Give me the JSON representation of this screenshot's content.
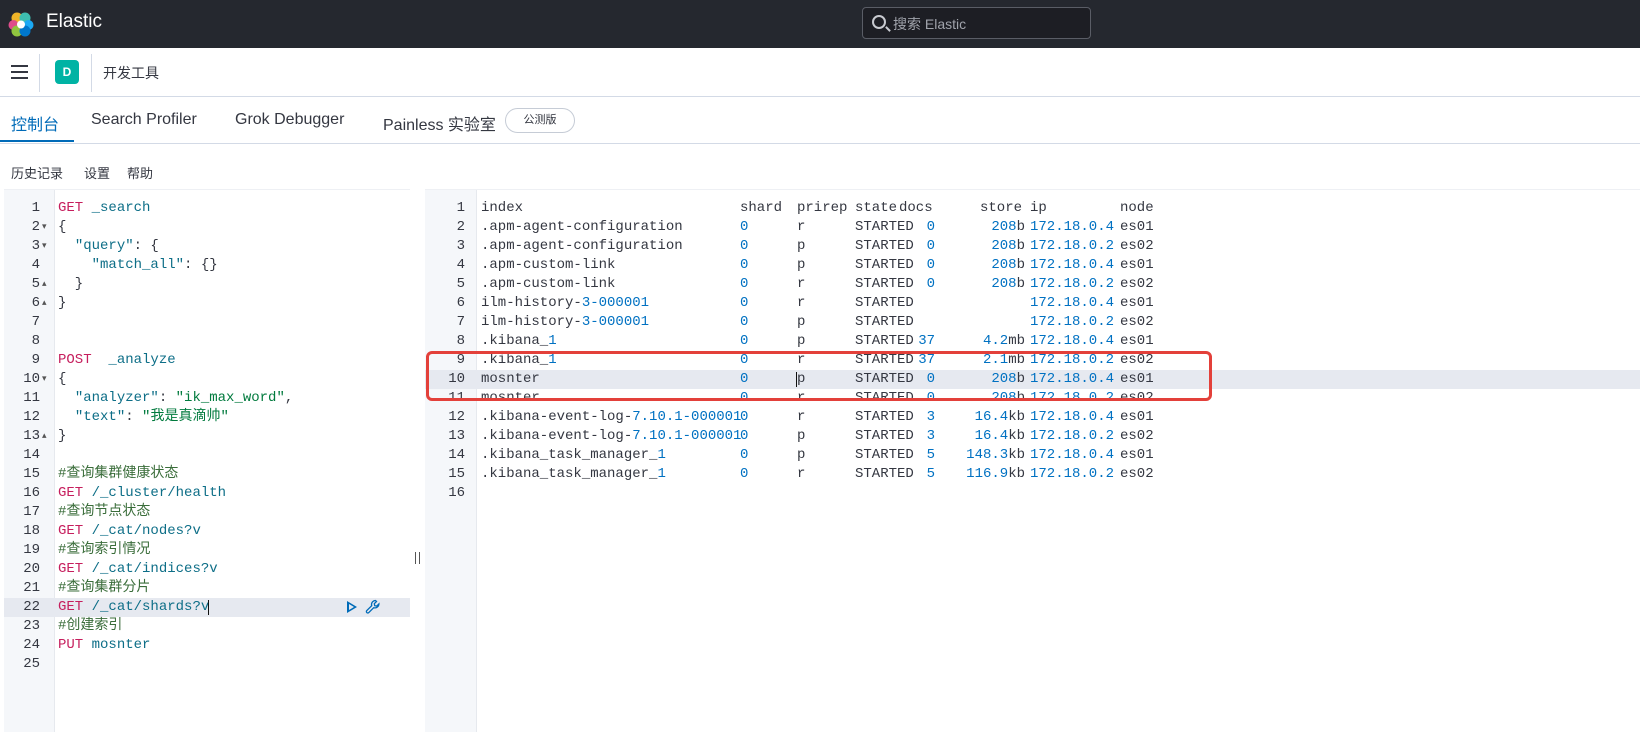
{
  "header": {
    "brand": "Elastic",
    "search_placeholder": "搜索 Elastic"
  },
  "subbar": {
    "avatar_letter": "D",
    "breadcrumb": "开发工具"
  },
  "tabs": [
    {
      "label": "控制台",
      "active": true
    },
    {
      "label": "Search Profiler"
    },
    {
      "label": "Grok Debugger"
    },
    {
      "label": "Painless 实验室"
    }
  ],
  "beta_badge": "公测版",
  "console_menu": [
    "历史记录",
    "设置",
    "帮助"
  ],
  "request_editor": {
    "lines": [
      {
        "n": "1",
        "fold": "",
        "text": "GET _search"
      },
      {
        "n": "2",
        "fold": "▾",
        "text": "{"
      },
      {
        "n": "3",
        "fold": "▾",
        "text": "  \"query\": {"
      },
      {
        "n": "4",
        "fold": "",
        "text": "    \"match_all\": {}"
      },
      {
        "n": "5",
        "fold": "▴",
        "text": "  }"
      },
      {
        "n": "6",
        "fold": "▴",
        "text": "}"
      },
      {
        "n": "7",
        "fold": "",
        "text": ""
      },
      {
        "n": "8",
        "fold": "",
        "text": ""
      },
      {
        "n": "9",
        "fold": "",
        "text": "POST  _analyze"
      },
      {
        "n": "10",
        "fold": "▾",
        "text": "{"
      },
      {
        "n": "11",
        "fold": "",
        "text": "  \"analyzer\": \"ik_max_word\","
      },
      {
        "n": "12",
        "fold": "",
        "text": "  \"text\": \"我是真滴帅\""
      },
      {
        "n": "13",
        "fold": "▴",
        "text": "}"
      },
      {
        "n": "14",
        "fold": "",
        "text": ""
      },
      {
        "n": "15",
        "fold": "",
        "text": "#查询集群健康状态"
      },
      {
        "n": "16",
        "fold": "",
        "text": "GET /_cluster/health"
      },
      {
        "n": "17",
        "fold": "",
        "text": "#查询节点状态"
      },
      {
        "n": "18",
        "fold": "",
        "text": "GET /_cat/nodes?v"
      },
      {
        "n": "19",
        "fold": "",
        "text": "#查询索引情况"
      },
      {
        "n": "20",
        "fold": "",
        "text": "GET /_cat/indices?v"
      },
      {
        "n": "21",
        "fold": "",
        "text": "#查询集群分片"
      },
      {
        "n": "22",
        "fold": "",
        "text": "GET /_cat/shards?v"
      },
      {
        "n": "23",
        "fold": "",
        "text": "#创建索引"
      },
      {
        "n": "24",
        "fold": "",
        "text": "PUT mosnter"
      },
      {
        "n": "25",
        "fold": "",
        "text": ""
      }
    ],
    "active_line": 22,
    "action_icons": [
      "play-icon",
      "wrench-icon"
    ]
  },
  "response_table": {
    "headers": [
      "index",
      "shard",
      "prirep",
      "state",
      "docs",
      "store",
      "ip",
      "node"
    ],
    "rows": [
      [
        ".apm-agent-configuration",
        "0",
        "r",
        "STARTED",
        "0",
        "208b",
        "172.18.0.4",
        "es01"
      ],
      [
        ".apm-agent-configuration",
        "0",
        "p",
        "STARTED",
        "0",
        "208b",
        "172.18.0.2",
        "es02"
      ],
      [
        ".apm-custom-link",
        "0",
        "p",
        "STARTED",
        "0",
        "208b",
        "172.18.0.4",
        "es01"
      ],
      [
        ".apm-custom-link",
        "0",
        "r",
        "STARTED",
        "0",
        "208b",
        "172.18.0.2",
        "es02"
      ],
      [
        "ilm-history-3-000001",
        "0",
        "r",
        "STARTED",
        "",
        "",
        "172.18.0.4",
        "es01"
      ],
      [
        "ilm-history-3-000001",
        "0",
        "p",
        "STARTED",
        "",
        "",
        "172.18.0.2",
        "es02"
      ],
      [
        ".kibana_1",
        "0",
        "p",
        "STARTED",
        "37",
        "4.2mb",
        "172.18.0.4",
        "es01"
      ],
      [
        ".kibana_1",
        "0",
        "r",
        "STARTED",
        "37",
        "2.1mb",
        "172.18.0.2",
        "es02"
      ],
      [
        "mosnter",
        "0",
        "p",
        "STARTED",
        "0",
        "208b",
        "172.18.0.4",
        "es01"
      ],
      [
        "mosnter",
        "0",
        "r",
        "STARTED",
        "0",
        "208b",
        "172.18.0.2",
        "es02"
      ],
      [
        ".kibana-event-log-7.10.1-000001",
        "0",
        "r",
        "STARTED",
        "3",
        "16.4kb",
        "172.18.0.4",
        "es01"
      ],
      [
        ".kibana-event-log-7.10.1-000001",
        "0",
        "p",
        "STARTED",
        "3",
        "16.4kb",
        "172.18.0.2",
        "es02"
      ],
      [
        ".kibana_task_manager_1",
        "0",
        "p",
        "STARTED",
        "5",
        "148.3kb",
        "172.18.0.4",
        "es01"
      ],
      [
        ".kibana_task_manager_1",
        "0",
        "r",
        "STARTED",
        "5",
        "116.9kb",
        "172.18.0.2",
        "es02"
      ]
    ],
    "line_numbers": [
      "1",
      "2",
      "3",
      "4",
      "5",
      "6",
      "7",
      "8",
      "9",
      "10",
      "11",
      "12",
      "13",
      "14",
      "15",
      "16"
    ],
    "highlighted_line": 10
  },
  "colors": {
    "accent": "#006bb8",
    "header_bg": "#25282f",
    "method": "#c61e5d",
    "annotation_box": "#e3403a"
  }
}
